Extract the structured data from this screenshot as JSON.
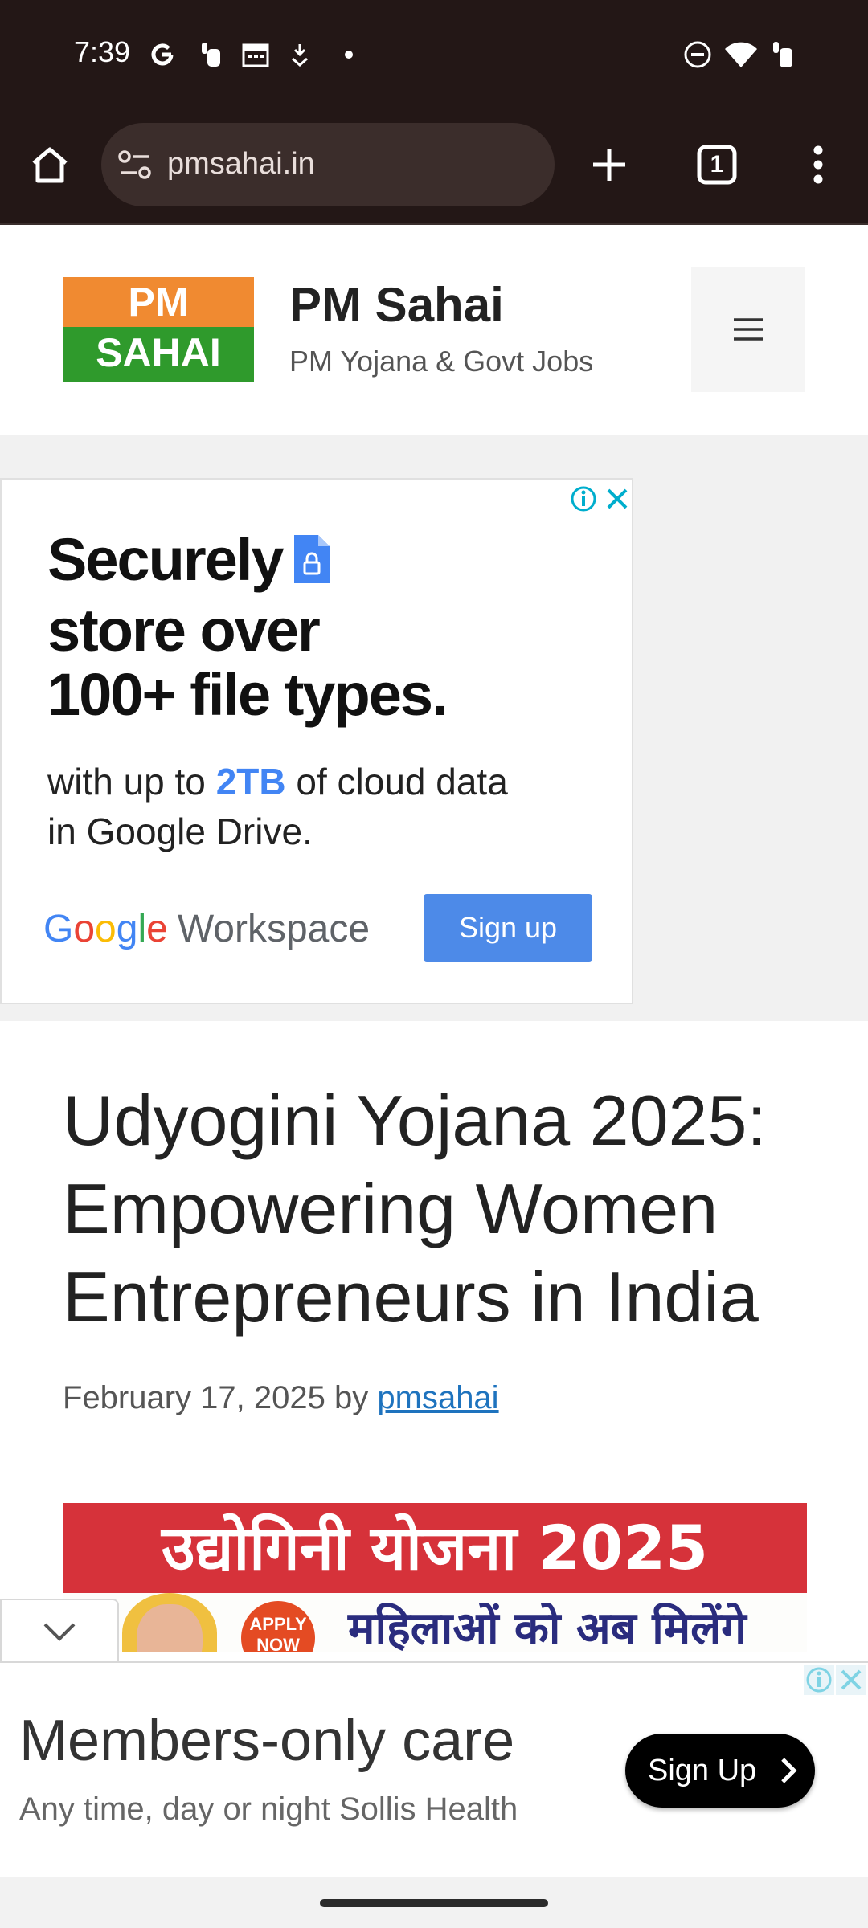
{
  "status_bar": {
    "time": "7:39",
    "left_icons": [
      "google-g-icon",
      "tap-hold-icon",
      "calendar-icon",
      "download-icon",
      "dot-icon"
    ],
    "right_icons": [
      "dnd-icon",
      "wifi-icon",
      "battery-icon"
    ]
  },
  "browser": {
    "url": "pmsahai.in",
    "tab_count": "1",
    "icons": [
      "home-icon",
      "site-info-icon",
      "new-tab-icon",
      "tab-switcher-icon",
      "more-menu-icon"
    ]
  },
  "site": {
    "logo_top": "PM",
    "logo_bottom": "SAHAI",
    "title": "PM Sahai",
    "tagline": "PM Yojana & Govt Jobs",
    "logo_colors": {
      "top": "#f08a31",
      "bottom": "#2f9a2c"
    }
  },
  "ad1": {
    "headline_lines": [
      "Securely",
      "store over",
      "100+ file types."
    ],
    "body_before": "with up to ",
    "body_highlight": "2TB",
    "body_after": " of cloud data",
    "body_line2": "in Google Drive.",
    "brand_google": "Google",
    "brand_product": "Workspace",
    "cta": "Sign up",
    "cta_color": "#4d8ae8"
  },
  "article": {
    "title_lines": [
      "Udyogini Yojana 2025:",
      "Empowering Women",
      "Entrepreneurs in India"
    ],
    "date": "February 17, 2025",
    "by": "by",
    "author": "pmsahai",
    "image_title": "उद्योगिनी योजना 2025",
    "image_subtitle": "महिलाओं को अब मिलेंगे",
    "image_badge_line1": "APPLY",
    "image_badge_line2": "NOW"
  },
  "anchor_ad": {
    "headline": "Members-only care",
    "subtext": "Any time, day or night Sollis Health",
    "cta": "Sign Up"
  }
}
